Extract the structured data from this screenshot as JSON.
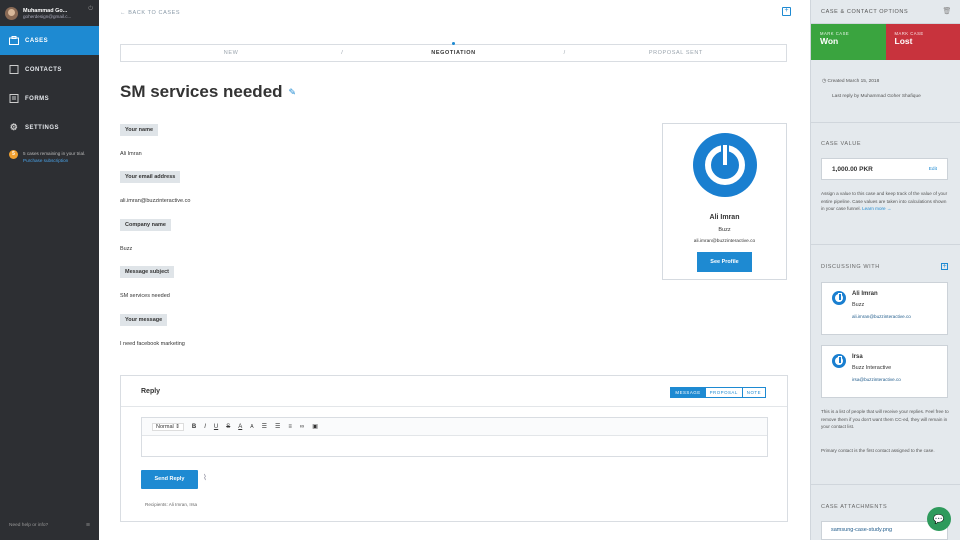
{
  "sidebar": {
    "user_name": "Muhammad Go...",
    "user_email": "goherdesign@gmail.c...",
    "items": [
      {
        "label": "CASES"
      },
      {
        "label": "CONTACTS"
      },
      {
        "label": "FORMS"
      },
      {
        "label": "SETTINGS"
      }
    ],
    "trial_count": "5",
    "trial_text": "5 cases remaining in your trial.",
    "trial_link": "Purchase subscription",
    "help": "Need help or info?"
  },
  "main": {
    "back": "← BACK TO CASES",
    "stages": [
      "NEW",
      "NEGOTIATION",
      "PROPOSAL SENT"
    ],
    "current_stage": "NEGOTIATION",
    "title": "SM services needed",
    "fields": [
      {
        "label": "Your name",
        "value": "Ali Imran"
      },
      {
        "label": "Your email address",
        "value": "ali.imran@buzzinteractive.co"
      },
      {
        "label": "Company name",
        "value": "Buzz"
      },
      {
        "label": "Message subject",
        "value": "SM services needed"
      },
      {
        "label": "Your message",
        "value": "I need facebook marketing"
      }
    ],
    "card": {
      "name": "Ali Imran",
      "company": "Buzz",
      "email": "ali.imran@buzzinteractive.co",
      "button": "See Profile"
    },
    "reply": {
      "title": "Reply",
      "tabs": [
        "MESSAGE",
        "PROPOSAL",
        "NOTE"
      ],
      "active_tab": "MESSAGE",
      "format": "Normal",
      "send": "Send Reply",
      "recipients": "Recipients: Ali Imran, Irsa"
    }
  },
  "right": {
    "header": "CASE & CONTACT OPTIONS",
    "won_small": "MARK CASE",
    "won": "Won",
    "lost_small": "MARK CASE",
    "lost": "Lost",
    "created": "Created March 15, 2018",
    "last_reply": "Last reply by Muhammad Goher Shafique",
    "case_value_title": "CASE VALUE",
    "case_value": "1,000.00 PKR",
    "edit": "Edit",
    "value_desc": "Assign a value to this case and keep track of the value of your entire pipeline. Case values are taken into calculations shown in your case funnel.",
    "learn_more": "Learn more →",
    "discussing_title": "DISCUSSING WITH",
    "contacts": [
      {
        "name": "Ali Imran",
        "company": "Buzz",
        "email": "ali.imran@buzzinteractive.co"
      },
      {
        "name": "Irsa",
        "company": "Buzz Interactive",
        "email": "irsa@buzzinteractive.co"
      }
    ],
    "contacts_desc": "This is a list of people that will receive your replies. Feel free to remove them if you don't want them CC-ed, they will remain in your contact list.",
    "primary_desc": "Primary contact is the first contact assigned to the case.",
    "attachments_title": "CASE ATTACHMENTS",
    "attachment": "samsung-case-study.png"
  },
  "colors": {
    "accent": "#1e8ad2",
    "won": "#3aa43f",
    "lost": "#c8333d",
    "sidebar": "#2d2f33"
  }
}
